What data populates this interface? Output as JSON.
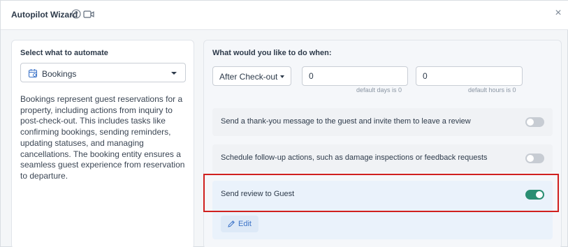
{
  "header": {
    "title": "Autopilot Wizard",
    "help_icon": "question-circle-icon",
    "video_icon": "video-camera-icon",
    "close_icon": "close-icon",
    "close_glyph": "×"
  },
  "left_panel": {
    "label": "Select what to automate",
    "select": {
      "icon": "calendar-icon",
      "value": "Bookings"
    },
    "description": "Bookings represent guest reservations for a property, including actions from inquiry to post-check-out. This includes tasks like confirming bookings, sending reminders, updating statuses, and managing cancellations. The booking entity ensures a seamless guest experience from reservation to departure."
  },
  "right_panel": {
    "question": "What would you like to do when:",
    "trigger": {
      "value": "After Check-out"
    },
    "days": {
      "value": "0",
      "hint": "default days is 0"
    },
    "hours": {
      "value": "0",
      "hint": "default hours is 0"
    },
    "options": [
      {
        "text": "Send a thank-you message to the guest and invite them to leave a review",
        "enabled": false
      },
      {
        "text": "Schedule follow-up actions, such as damage inspections or feedback requests",
        "enabled": false
      },
      {
        "text": "Send review to Guest",
        "enabled": true,
        "edit_label": "Edit",
        "edit_icon": "pencil-icon"
      }
    ]
  },
  "colors": {
    "accent_toggle_on": "#2a8e72",
    "toggle_off": "#c7ccd3",
    "edit_link": "#3d74c8",
    "highlight_border": "#d0201e"
  }
}
